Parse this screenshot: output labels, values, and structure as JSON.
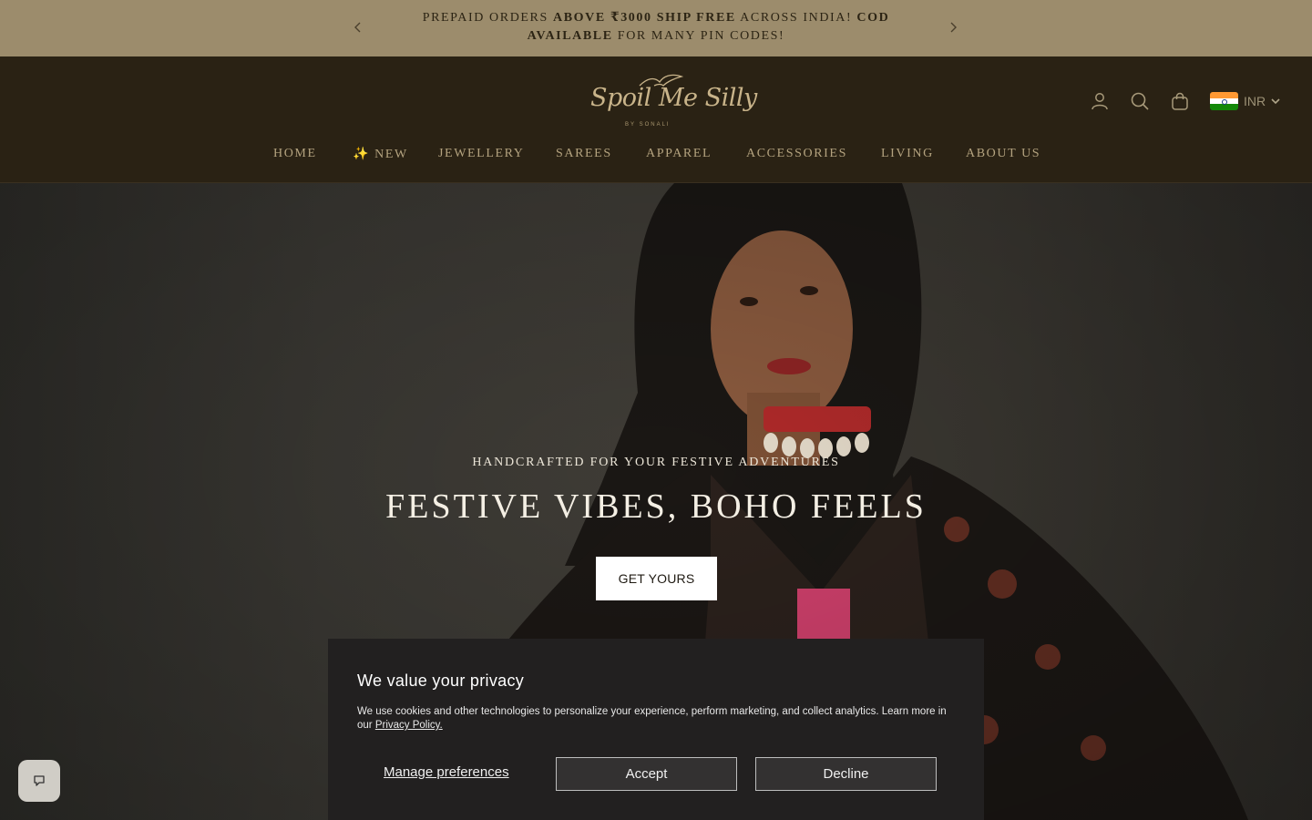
{
  "announcement": {
    "line1_a": "Prepaid orders ",
    "line1_b": "above ₹3000 ship free",
    "line1_c": " across India! ",
    "line1_d": "COD available",
    "line1_e": " for many PIN codes!"
  },
  "header": {
    "logo_text": "Spoil Me Silly",
    "logo_byline": "BY SONALI",
    "currency": "INR"
  },
  "nav": {
    "items": [
      {
        "label": "HOME"
      },
      {
        "label": "✨ NEW"
      },
      {
        "label": "JEWELLERY"
      },
      {
        "label": "SAREES"
      },
      {
        "label": "APPAREL"
      },
      {
        "label": "ACCESSORIES"
      },
      {
        "label": "LIVING"
      },
      {
        "label": "ABOUT US"
      }
    ]
  },
  "hero": {
    "subtitle": "HANDCRAFTED FOR YOUR FESTIVE ADVENTURES",
    "title": "FESTIVE VIBES, BOHO FEELS",
    "cta": "GET YOURS"
  },
  "cookie": {
    "title": "We value your privacy",
    "body": "We use cookies and other technologies to personalize your experience, perform marketing, and collect analytics. Learn more in our ",
    "link": "Privacy Policy.",
    "manage": "Manage preferences",
    "accept": "Accept",
    "decline": "Decline"
  },
  "icons": {
    "prev": "chevron-left-icon",
    "next": "chevron-right-icon",
    "account": "user-icon",
    "search": "search-icon",
    "cart": "bag-icon",
    "chat": "chat-icon"
  },
  "colors": {
    "announcement_bg": "#9c8c6c",
    "header_bg": "#2a2214",
    "nav_text": "#b4a37f",
    "cookie_bg": "#222020"
  }
}
